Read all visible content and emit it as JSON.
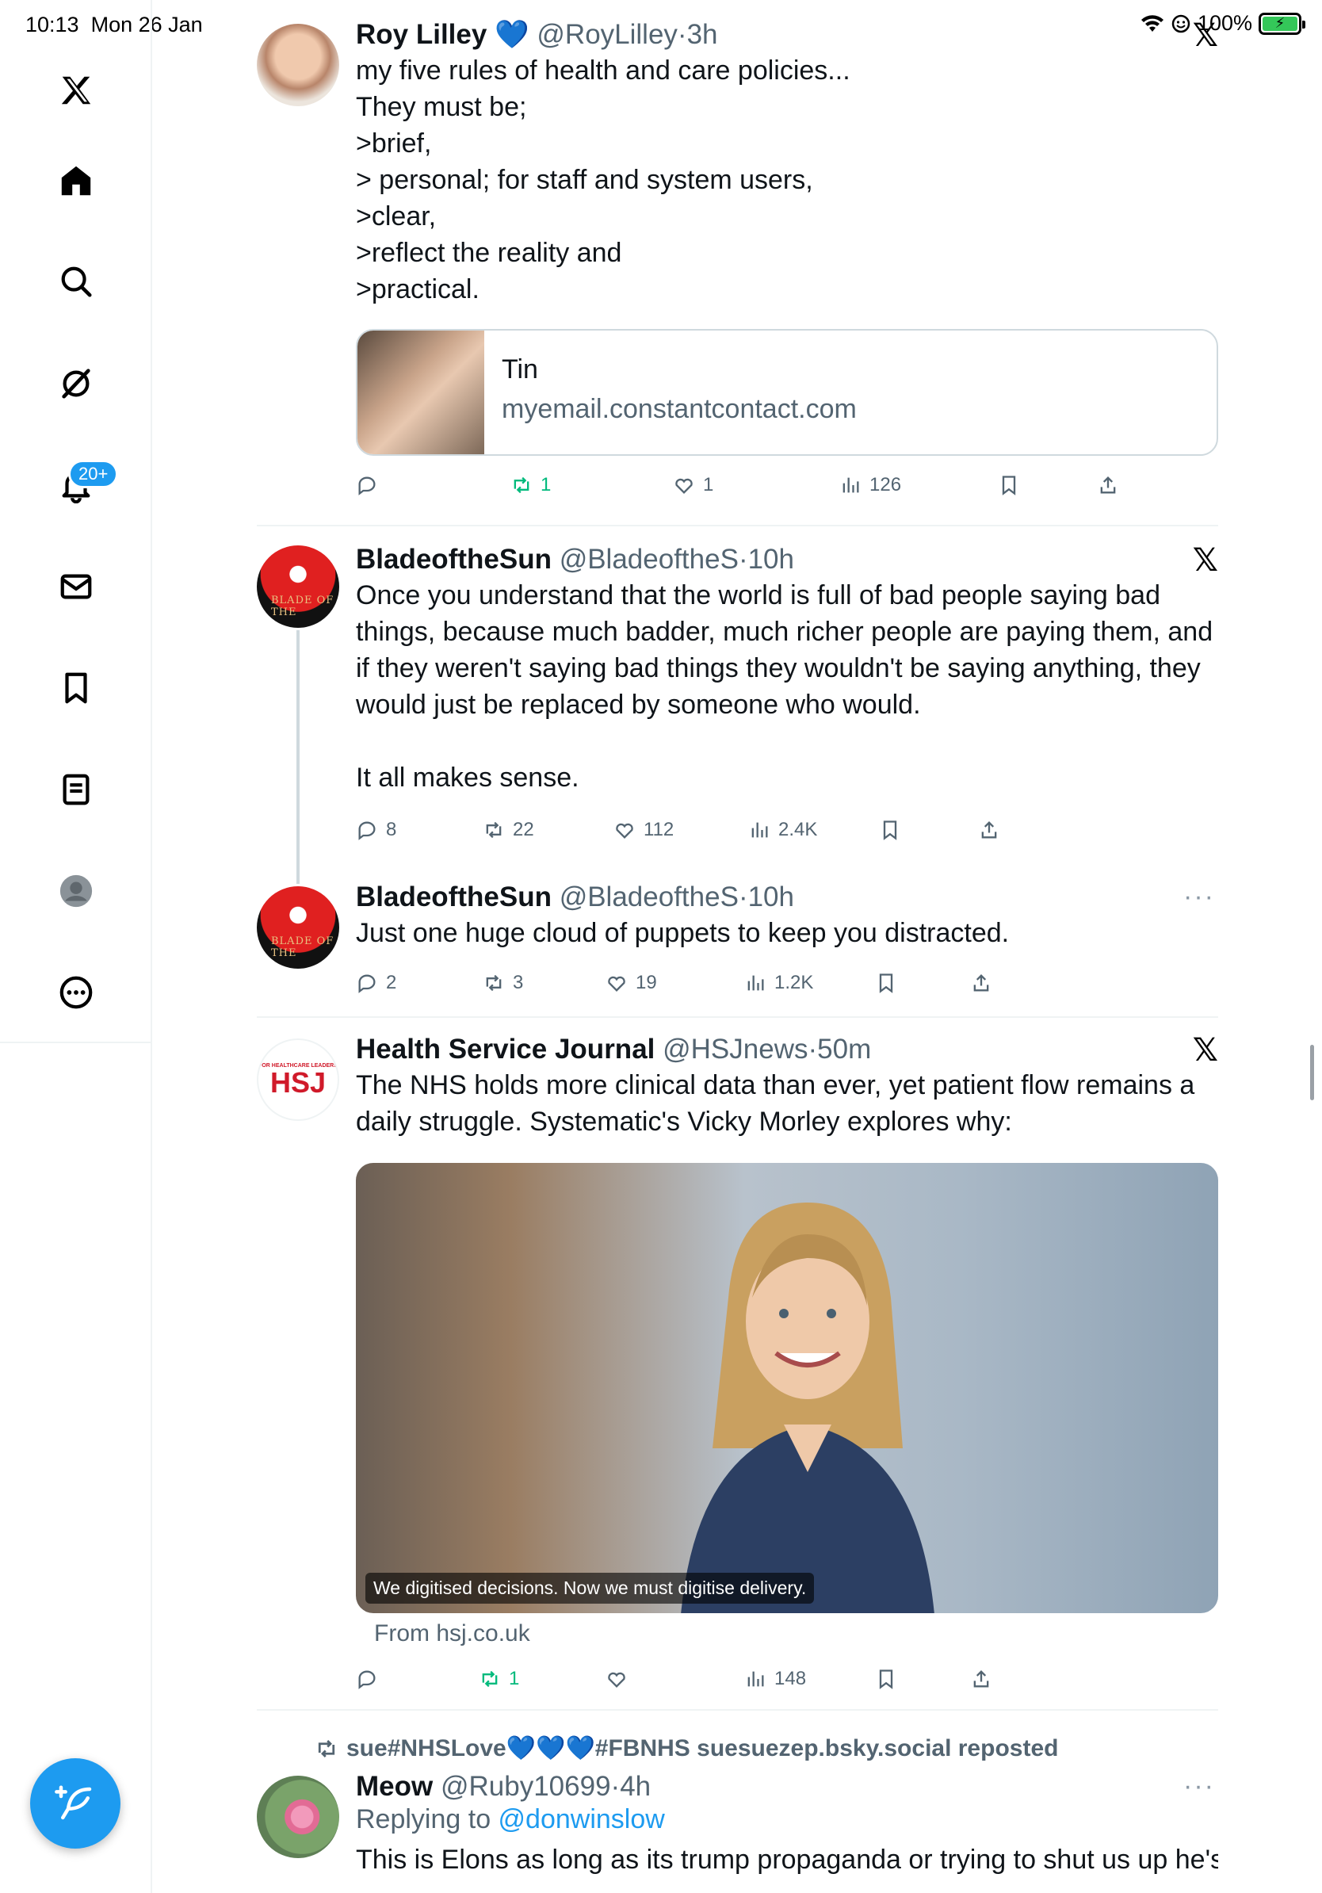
{
  "status": {
    "time": "10:13",
    "date": "Mon 26 Jan",
    "battery": "100%"
  },
  "sidebar": {
    "notifications_badge": "20+",
    "items": [
      "x-logo",
      "home",
      "search",
      "grok",
      "notifications",
      "messages",
      "bookmarks",
      "lists",
      "profile",
      "more"
    ]
  },
  "tweets": [
    {
      "name": "Roy Lilley",
      "verified_emoji": "💙",
      "handle": "@RoyLilley",
      "time": "3h",
      "text": "my five rules of health and care policies...\nThey must be;\n>brief,\n> personal; for staff and system users,\n>clear,\n>reflect the reality and\n>practical.",
      "card": {
        "title": "Tin",
        "domain": "myemail.constantcontact.com"
      },
      "replies": "",
      "reposts": "1",
      "likes": "1",
      "views": "126"
    },
    {
      "name": "BladeoftheSun",
      "handle": "@BladeoftheS",
      "time": "10h",
      "text": "Once you understand that the world is full of bad people saying bad things, because much badder, much richer people are paying them, and if they weren't saying bad things they wouldn't be saying anything, they would just be replaced by someone who would.\n\nIt all makes sense.",
      "replies": "8",
      "reposts": "22",
      "likes": "112",
      "views": "2.4K"
    },
    {
      "name": "BladeoftheSun",
      "handle": "@BladeoftheS",
      "time": "10h",
      "text": "Just one huge cloud of puppets to keep you distracted.",
      "replies": "2",
      "reposts": "3",
      "likes": "19",
      "views": "1.2K"
    },
    {
      "name": "Health Service Journal",
      "handle": "@HSJnews",
      "time": "50m",
      "text": "The NHS holds more clinical data than ever, yet patient flow remains a daily struggle. Systematic's Vicky Morley explores why:",
      "media_caption": "We digitised decisions. Now we must digitise delivery.",
      "from": "From hsj.co.uk",
      "avatar_text": "HSJ",
      "avatar_small": "FOR HEALTHCARE LEADERS",
      "replies": "",
      "reposts": "1",
      "likes": "",
      "views": "148"
    },
    {
      "reposted_by": "sue#NHSLove💙💙💙#FBNHS suesuezep.bsky.social reposted",
      "name": "Meow",
      "handle": "@Ruby10699",
      "time": "4h",
      "replying_label": "Replying to ",
      "replying_to": "@donwinslow",
      "text": "This is Elons as long as its trump propaganda or trying to shut us up he's"
    }
  ],
  "separator": "·",
  "blade_avatar_text": "BLADE OF THE"
}
